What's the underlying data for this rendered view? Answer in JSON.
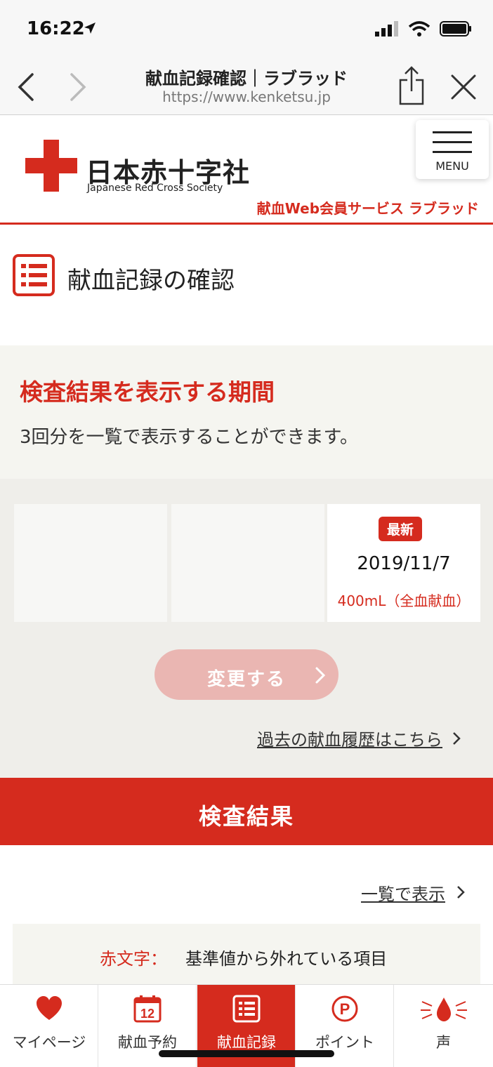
{
  "status": {
    "time": "16:22"
  },
  "browser": {
    "title": "献血記録確認｜ラブラッド",
    "url": "https://www.kenketsu.jp"
  },
  "header": {
    "logo_ja": "日本赤十字社",
    "logo_en": "Japanese Red Cross Society",
    "menu_label": "MENU",
    "service": "献血Web会員サービス ラブラッド"
  },
  "section": {
    "title": "献血記録の確認"
  },
  "period": {
    "heading": "検査結果を表示する期間",
    "description": "3回分を一覧で表示することができます。"
  },
  "records": {
    "latest_badge": "最新",
    "latest_date": "2019/11/7",
    "latest_volume": "400mL（全血献血）"
  },
  "actions": {
    "change_label": "変更する",
    "history_link": "過去の献血履歴はこちら"
  },
  "results": {
    "title": "検査結果",
    "list_link": "一覧で表示",
    "legend_key": "赤文字：",
    "legend_value": "基準値から外れている項目"
  },
  "tabs": [
    {
      "label": "マイページ",
      "icon": "heart-icon"
    },
    {
      "label": "献血予約",
      "icon": "calendar-icon",
      "calendar_day": "12"
    },
    {
      "label": "献血記録",
      "icon": "list-icon",
      "active": true
    },
    {
      "label": "ポイント",
      "icon": "point-icon",
      "point_letter": "P"
    },
    {
      "label": "声",
      "icon": "blood-drop-icon"
    }
  ],
  "colors": {
    "brand_red": "#d52b1e",
    "disabled_red": "#eab6b2"
  }
}
